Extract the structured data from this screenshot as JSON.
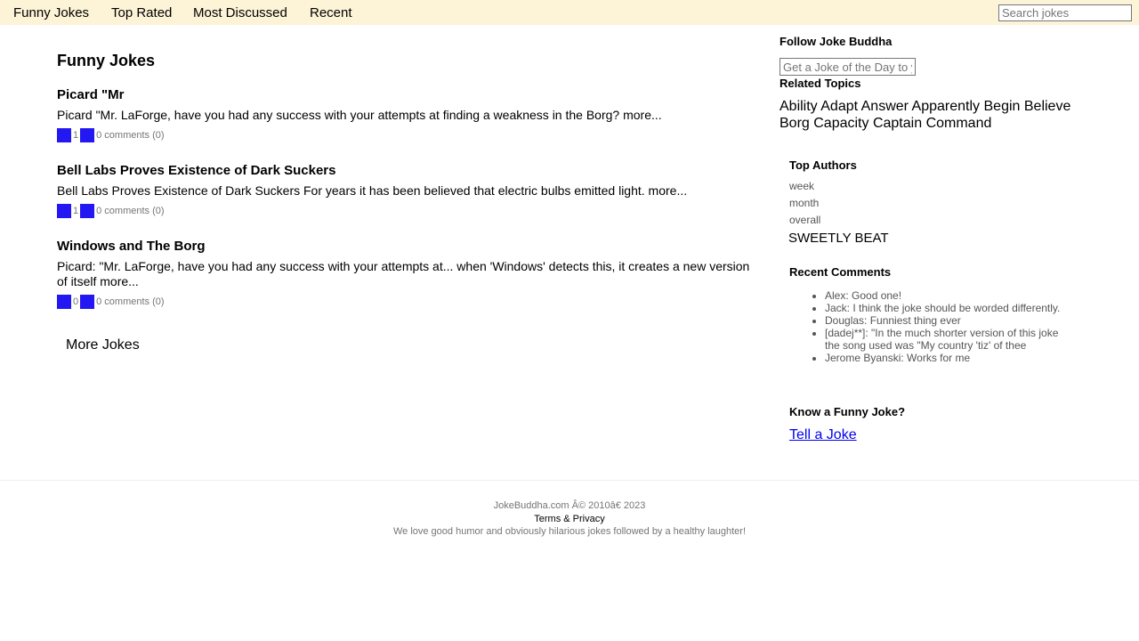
{
  "nav": {
    "items": [
      {
        "label": "Funny Jokes"
      },
      {
        "label": "Top Rated"
      },
      {
        "label": "Most Discussed"
      },
      {
        "label": "Recent"
      }
    ],
    "search_placeholder": "Search jokes"
  },
  "main": {
    "title": "Funny Jokes",
    "jokes": [
      {
        "title": "Picard \"Mr",
        "body": "Picard \"Mr. LaForge, have you had any success with your attempts at finding a weakness in the Borg? more...",
        "votes": "1",
        "comments": "0 comments (0)"
      },
      {
        "title": "Bell Labs Proves Existence of Dark Suckers",
        "body": "Bell Labs Proves Existence of Dark Suckers For years it has been believed that electric bulbs emitted light. more...",
        "votes": "1",
        "comments": "0 comments (0)"
      },
      {
        "title": "Windows and The Borg",
        "body": "Picard: \"Mr. LaForge, have you had any success with your attempts at... when 'Windows' detects this, it creates a new version of itself more...",
        "votes": "0",
        "comments": "0 comments (0)"
      }
    ],
    "more_label": "More Jokes",
    "vote_color": "#2418f2"
  },
  "sidebar": {
    "follow_heading": "Follow Joke Buddha",
    "subscribe_placeholder": "Get a Joke of the Day to your inbox",
    "related_heading": "Related Topics",
    "topics": [
      "Ability",
      "Adapt",
      "Answer",
      "Apparently",
      "Begin",
      "Believe",
      "Borg",
      "Capacity",
      "Captain",
      "Command"
    ],
    "authors_heading": "Top Authors",
    "periods": [
      "week",
      "month",
      "overall"
    ],
    "top_author": "SWEETLY BEAT",
    "comments_heading": "Recent Comments",
    "comments": [
      "Alex: Good one!",
      "Jack: I think the joke should be worded differently.",
      "Douglas: Funniest thing ever",
      "[dadej**]: \"In the much shorter version of this joke the song used was \"My country 'tiz' of thee",
      "Jerome Byanski: Works for me"
    ],
    "know_heading": "Know a Funny Joke?",
    "tell_link": "Tell a Joke"
  },
  "footer": {
    "copyright": "JokeBuddha.com Â© 2010â€   2023",
    "terms": "Terms & Privacy",
    "tagline": "We love good humor and obviously hilarious jokes followed by a healthy laughter!"
  },
  "colors": {
    "nav_background": "#fdf3d7",
    "vote_icon": "#2418f2",
    "link": "#0000ee"
  }
}
